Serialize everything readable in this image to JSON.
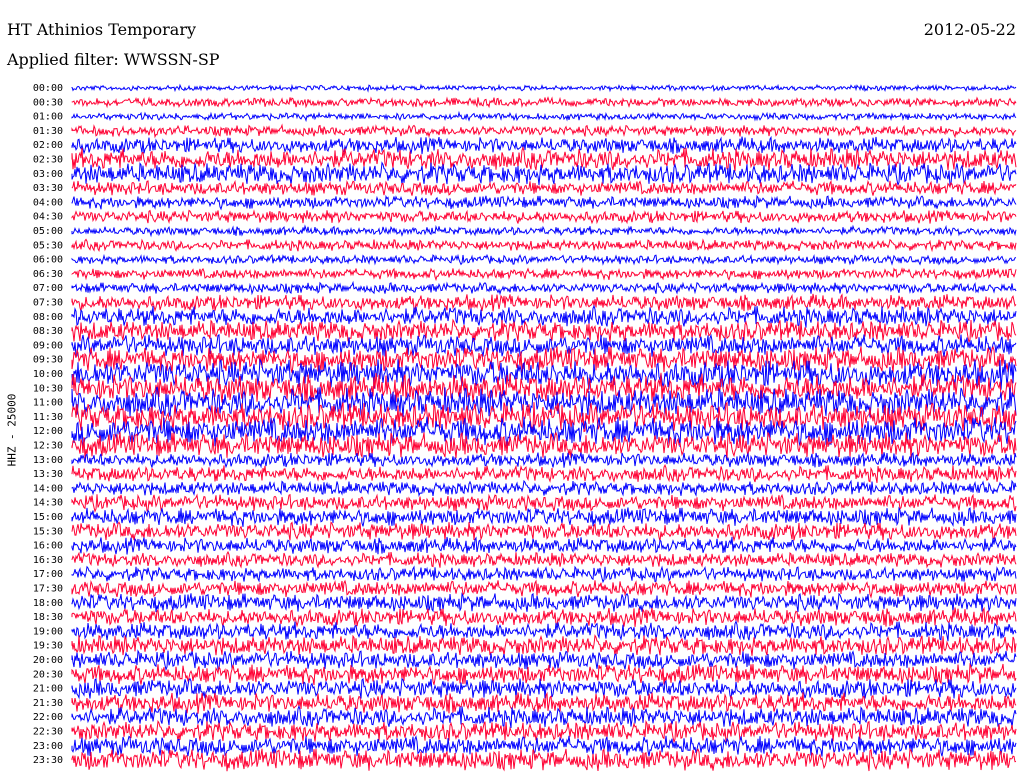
{
  "header": {
    "station": "HT Athinios Temporary",
    "filter": "Applied filter: WWSSN-SP",
    "date": "2012-05-22"
  },
  "chart_data": {
    "type": "line",
    "title": "HT Athinios Temporary",
    "ylabel": "HHZ - 25000",
    "colors": [
      "#0000ff",
      "#ff0033"
    ],
    "rows": [
      {
        "time": "00:00",
        "amp": 3,
        "color": "#0000ff"
      },
      {
        "time": "00:30",
        "amp": 5,
        "color": "#ff0033"
      },
      {
        "time": "01:00",
        "amp": 4,
        "color": "#0000ff"
      },
      {
        "time": "01:30",
        "amp": 6,
        "color": "#ff0033"
      },
      {
        "time": "02:00",
        "amp": 9,
        "color": "#0000ff"
      },
      {
        "time": "02:30",
        "amp": 12,
        "color": "#ff0033"
      },
      {
        "time": "03:00",
        "amp": 12,
        "color": "#0000ff"
      },
      {
        "time": "03:30",
        "amp": 8,
        "color": "#ff0033"
      },
      {
        "time": "04:00",
        "amp": 7,
        "color": "#0000ff"
      },
      {
        "time": "04:30",
        "amp": 7,
        "color": "#ff0033"
      },
      {
        "time": "05:00",
        "amp": 5,
        "color": "#0000ff"
      },
      {
        "time": "05:30",
        "amp": 6,
        "color": "#ff0033"
      },
      {
        "time": "06:00",
        "amp": 5,
        "color": "#0000ff"
      },
      {
        "time": "06:30",
        "amp": 6,
        "color": "#ff0033"
      },
      {
        "time": "07:00",
        "amp": 6,
        "color": "#0000ff"
      },
      {
        "time": "07:30",
        "amp": 9,
        "color": "#ff0033"
      },
      {
        "time": "08:00",
        "amp": 11,
        "color": "#0000ff"
      },
      {
        "time": "08:30",
        "amp": 12,
        "color": "#ff0033"
      },
      {
        "time": "09:00",
        "amp": 12,
        "color": "#0000ff"
      },
      {
        "time": "09:30",
        "amp": 14,
        "color": "#ff0033"
      },
      {
        "time": "10:00",
        "amp": 16,
        "color": "#0000ff"
      },
      {
        "time": "10:30",
        "amp": 16,
        "color": "#ff0033"
      },
      {
        "time": "11:00",
        "amp": 16,
        "color": "#0000ff"
      },
      {
        "time": "11:30",
        "amp": 16,
        "color": "#ff0033"
      },
      {
        "time": "12:00",
        "amp": 16,
        "color": "#0000ff"
      },
      {
        "time": "12:30",
        "amp": 14,
        "color": "#ff0033"
      },
      {
        "time": "13:00",
        "amp": 8,
        "color": "#0000ff"
      },
      {
        "time": "13:30",
        "amp": 9,
        "color": "#ff0033"
      },
      {
        "time": "14:00",
        "amp": 8,
        "color": "#0000ff"
      },
      {
        "time": "14:30",
        "amp": 9,
        "color": "#ff0033"
      },
      {
        "time": "15:00",
        "amp": 10,
        "color": "#0000ff"
      },
      {
        "time": "15:30",
        "amp": 10,
        "color": "#ff0033"
      },
      {
        "time": "16:00",
        "amp": 9,
        "color": "#0000ff"
      },
      {
        "time": "16:30",
        "amp": 8,
        "color": "#ff0033"
      },
      {
        "time": "17:00",
        "amp": 8,
        "color": "#0000ff"
      },
      {
        "time": "17:30",
        "amp": 9,
        "color": "#ff0033"
      },
      {
        "time": "18:00",
        "amp": 10,
        "color": "#0000ff"
      },
      {
        "time": "18:30",
        "amp": 10,
        "color": "#ff0033"
      },
      {
        "time": "19:00",
        "amp": 10,
        "color": "#0000ff"
      },
      {
        "time": "19:30",
        "amp": 11,
        "color": "#ff0033"
      },
      {
        "time": "20:00",
        "amp": 10,
        "color": "#0000ff"
      },
      {
        "time": "20:30",
        "amp": 11,
        "color": "#ff0033"
      },
      {
        "time": "21:00",
        "amp": 11,
        "color": "#0000ff"
      },
      {
        "time": "21:30",
        "amp": 11,
        "color": "#ff0033"
      },
      {
        "time": "22:00",
        "amp": 11,
        "color": "#0000ff"
      },
      {
        "time": "22:30",
        "amp": 11,
        "color": "#ff0033"
      },
      {
        "time": "23:00",
        "amp": 11,
        "color": "#0000ff"
      },
      {
        "time": "23:30",
        "amp": 12,
        "color": "#ff0033"
      }
    ]
  }
}
